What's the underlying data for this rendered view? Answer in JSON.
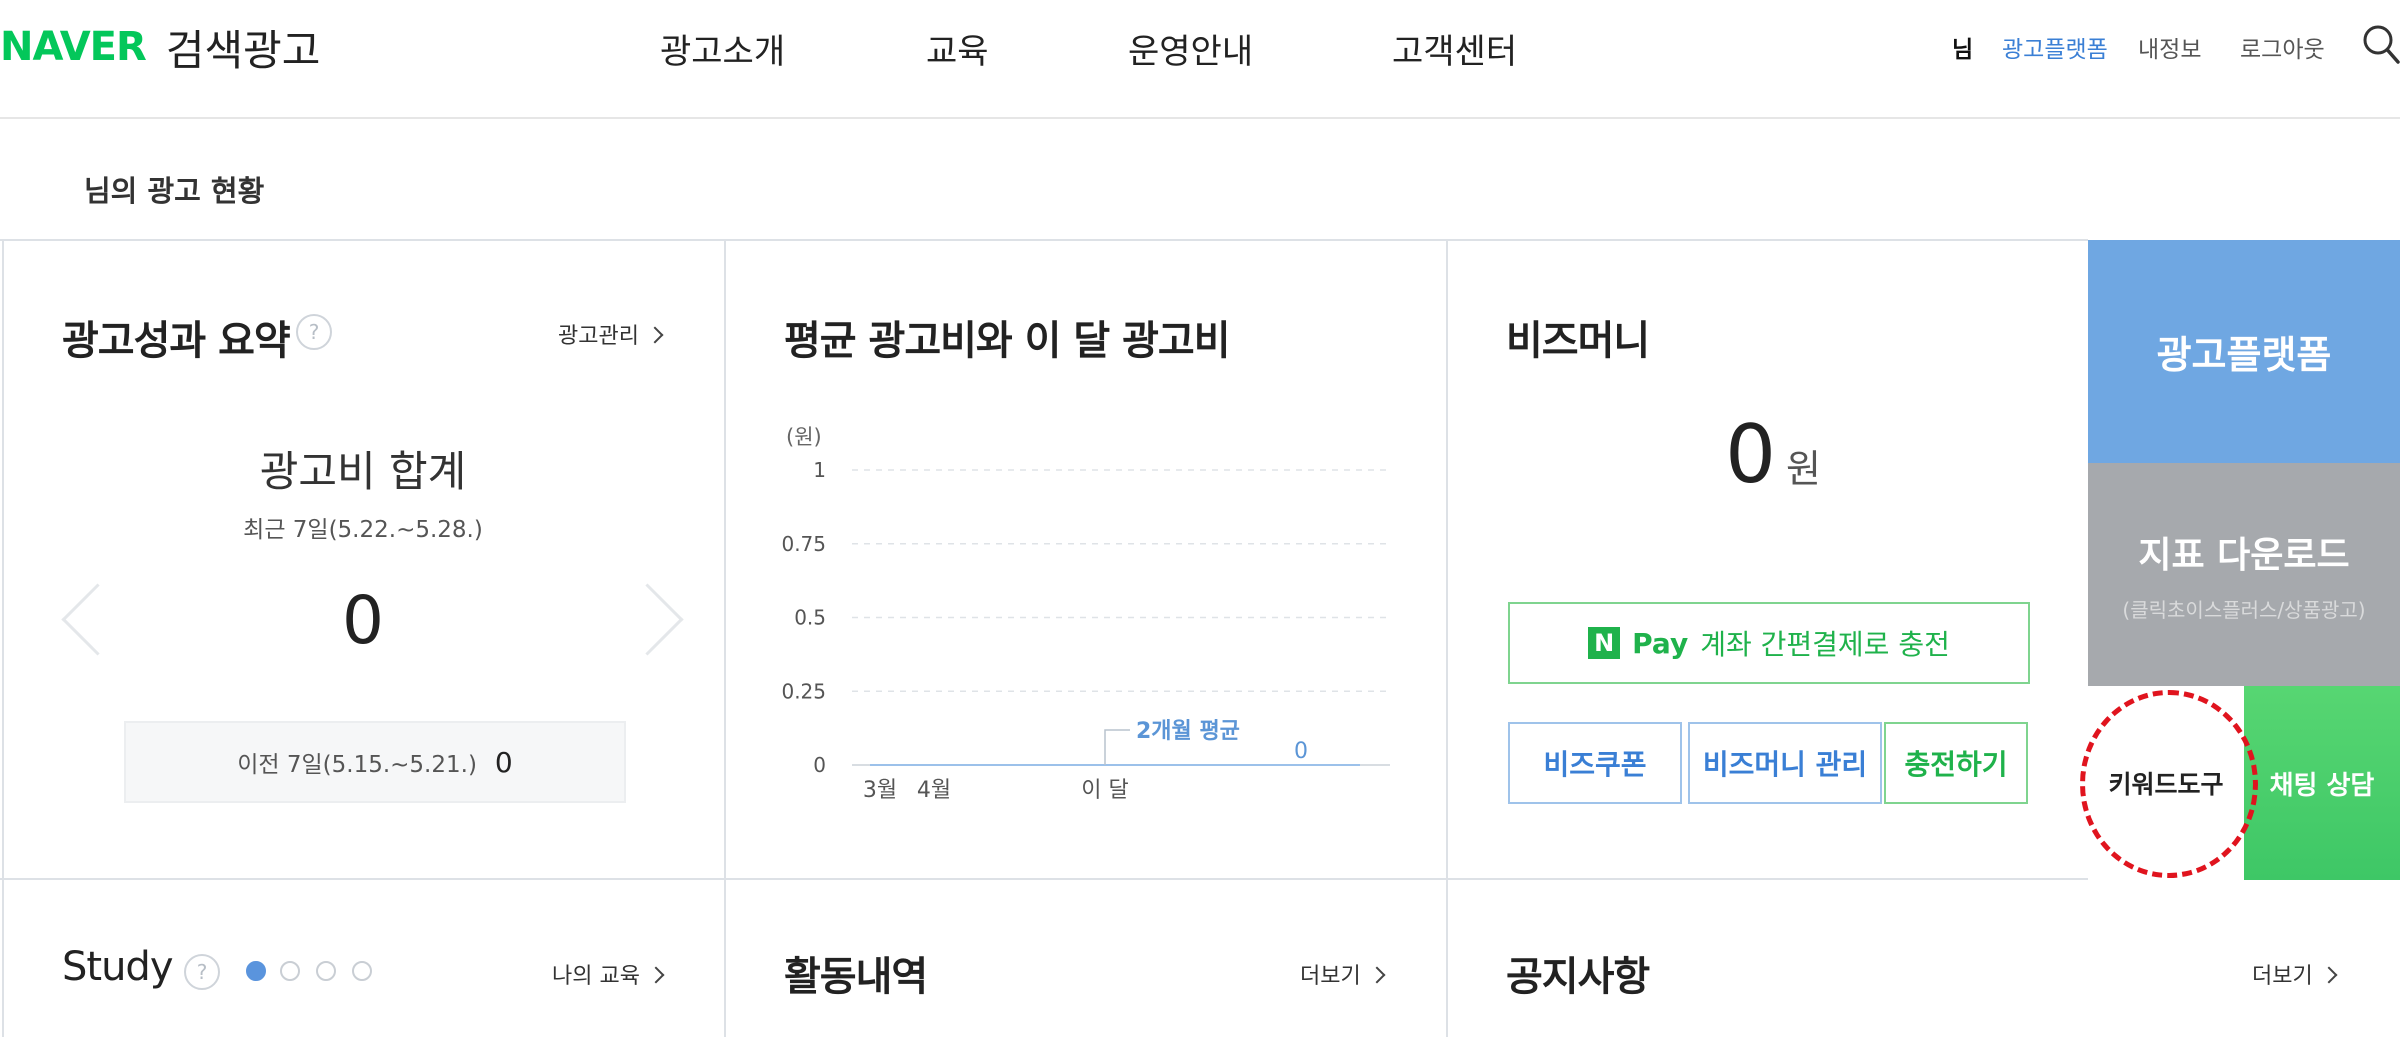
{
  "header": {
    "logo_brand": "NAVER",
    "logo_service": "검색광고",
    "nav": [
      "광고소개",
      "교육",
      "운영안내",
      "고객센터"
    ],
    "user_suffix": "님",
    "platform_link": "광고플랫폼",
    "my_info": "내정보",
    "logout": "로그아웃",
    "search_icon": "search-icon"
  },
  "section_title": "님의 광고 현황",
  "summary": {
    "title": "광고성과 요약",
    "help": "?",
    "manage_link": "광고관리",
    "spend_label": "광고비 합계",
    "period": "최근 7일(5.22.~5.28.)",
    "spend_value": "0",
    "prev_label": "이전 7일(5.15.~5.21.)",
    "prev_value": "0"
  },
  "chart_section": {
    "title": "평균 광고비와 이 달 광고비"
  },
  "chart_data": {
    "type": "bar",
    "ylabel": "(원)",
    "ylim": [
      0,
      1
    ],
    "yticks": [
      "1",
      "0.75",
      "0.5",
      "0.25",
      "0"
    ],
    "categories": [
      "3월",
      "4월",
      "이 달"
    ],
    "values": [
      0,
      0,
      0
    ],
    "grid": true,
    "annotation_label": "2개월 평균",
    "annotation_value": "0"
  },
  "bizmoney": {
    "title": "비즈머니",
    "value": "0",
    "unit": "원",
    "npay_logo": "N",
    "npay_pay": "Pay",
    "npay_text": "계좌 간편결제로 충전",
    "coupon": "비즈쿠폰",
    "manage": "비즈머니 관리",
    "charge": "충전하기"
  },
  "tiles": {
    "platform": "광고플랫폼",
    "download": "지표 다운로드",
    "download_sub": "(클릭초이스플러스/상품광고)",
    "keyword": "키워드도구",
    "chat": "채팅 상담"
  },
  "bottom": {
    "study_title": "Study",
    "study_help": "?",
    "study_link": "나의 교육",
    "activity_title": "활동내역",
    "activity_more": "더보기",
    "notice_title": "공지사항",
    "notice_more": "더보기"
  },
  "colors": {
    "naver_green": "#03c75a",
    "link_blue": "#3a7fd5",
    "tile_blue": "#6fa7e2",
    "tile_gray": "#a6a9ad",
    "tile_green": "#4fd06c",
    "highlight_red": "#e0141e"
  }
}
